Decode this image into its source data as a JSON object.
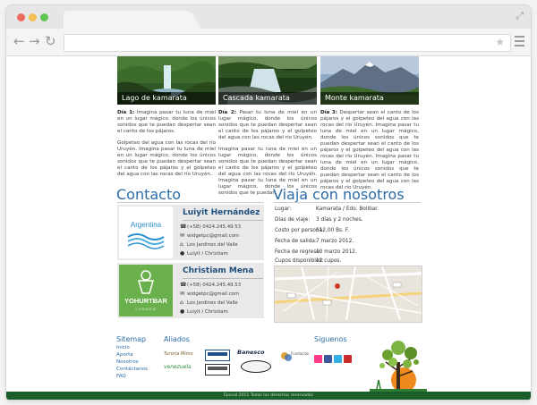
{
  "trip_days": [
    {
      "caption": "Lago de kamarata",
      "title": "Día 1:",
      "paragraphs": [
        "Imagina pasar tu luna de miel en un lugar mágico, donde los únicos sonidos que te puedan despertar sean el canto de los pájaros.",
        "Golpeteo del agua con las rocas del río Uruyén. Imagina pasar tu luna de miel en un lugar mágico, donde los únicos sonidos que te puedan despertar sean el canto de los pájaros y el golpeteo del agua con las rocas del río Uruyén."
      ]
    },
    {
      "caption": "Cascada kamarata",
      "title": "Día 2:",
      "paragraphs": [
        "Pasar tu luna de miel en un lugar mágico, donde los únicos sonidos que te puedan despertar sean el canto de los pájaros y el golpeteo del agua con las rocas del río Uruyén.",
        "Imagina pasar tu luna de miel en un lugar mágico, donde los únicos sonidos que te puedan despertar sean el canto de los pájaros y el golpeteo del agua con las rocas del río Uruyén. Imagina pasar tu luna de miel en un lugar mágico, donde los únicos sonidos que te puedan."
      ]
    },
    {
      "caption": "Monte kamarata",
      "title": "Día 3:",
      "paragraphs": [
        "Despertar sean el canto de los pájaros y el golpeteo del agua con las rocas del río Uruyén. Imagina pasar tu luna de miel en un lugar mágico, donde los únicos sonidos que te puedan despertar sean el canto de los pájaros y el golpeteo del agua con las rocas del río Uruyén. Imagina pasar tu luna de miel en un lugar mágico, donde los únicos sonidos que te puedan despertar sean el canto de los pájaros y el golpeteo del agua con las rocas del río Uruyén."
      ]
    }
  ],
  "contact": {
    "heading": "Contacto",
    "cards": [
      {
        "logo_text": "Argentina",
        "name": "Luiyit Hernández",
        "phone": "(+58) 0424.245.49.53",
        "email": "widgetpc@gmail.com",
        "address": "Los Jardines del Valle",
        "person": "Luiyit / Christiam"
      },
      {
        "logo_text": "YOHURTBAR",
        "logo_sub": "LONDON",
        "name": "Christiam Mena",
        "phone": "(+58) 0424.245.49.53",
        "email": "widgetpc@gmail.com",
        "address": "Los Jardines del Valle",
        "person": "Luiyit / Christiam"
      }
    ]
  },
  "trip": {
    "heading": "Viaja con nosotros",
    "rows": [
      {
        "label": "Lugar:",
        "value": "Kamarata / Edo. Bolibar."
      },
      {
        "label": "Días de viaje:",
        "value": "3 días y 2 noches."
      },
      {
        "label": "Costo por persona:",
        "value": "512,00 Bs. F."
      },
      {
        "label": "Fecha de salida:",
        "value": "7 marzo 2012."
      },
      {
        "label": "Fecha de regreso:",
        "value": "10 marzo 2012."
      },
      {
        "label": "Cupos disponibles:",
        "value": "12 cupos."
      }
    ]
  },
  "footer": {
    "sitemap_heading": "Sitemap",
    "sitemap_links": [
      "Inicio",
      "Aporta",
      "Nosotros",
      "Contáctanos",
      "FAQ"
    ],
    "allies_heading": "Aliados",
    "allies": [
      "Turoria Mimo",
      "venezuela",
      "Banesco",
      "Fundación"
    ],
    "social_heading": "Siguenos",
    "copyright": "Epocal 2011 Todos los derechos reservados"
  },
  "colors": {
    "heading_blue": "#2a6ba6",
    "footer_green": "#1b5e2a",
    "yohurt_green": "#6ab04c"
  },
  "icons": [
    "phone-icon",
    "email-icon",
    "home-icon",
    "user-icon",
    "flickr-icon",
    "facebook-icon",
    "twitter-icon",
    "youtube-icon"
  ]
}
